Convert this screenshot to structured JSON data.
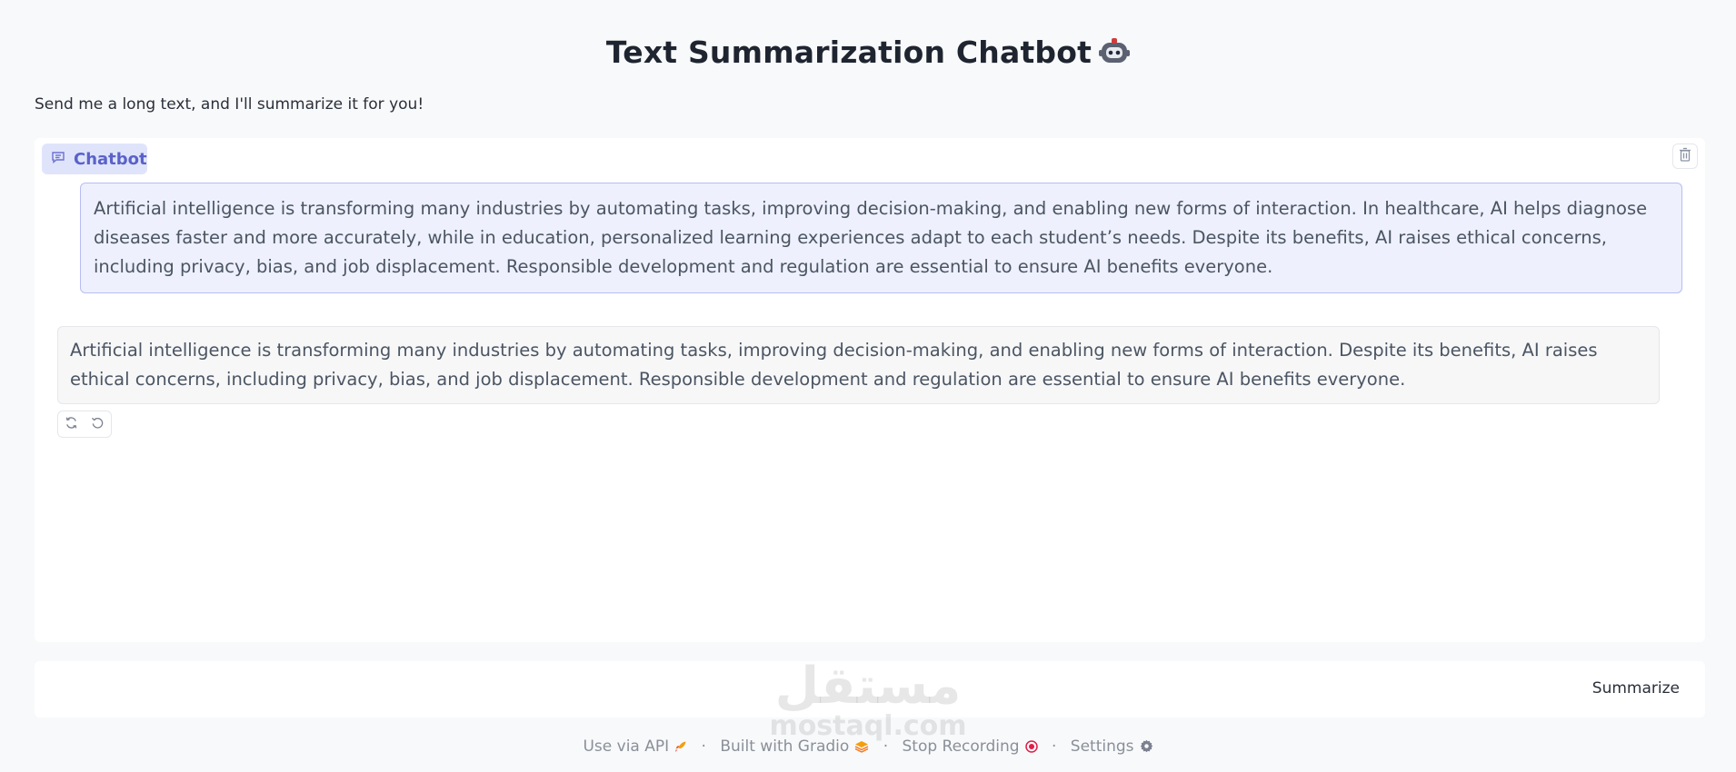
{
  "header": {
    "title": "Text Summarization Chatbot",
    "subtitle": "Send me a long text, and I'll summarize it for you!"
  },
  "chatbot": {
    "label": "Chatbot",
    "messages": [
      {
        "role": "user",
        "text": "Artificial intelligence is transforming many industries by automating tasks, improving decision-making, and enabling new forms of interaction. In healthcare, AI helps diagnose diseases faster and more accurately, while in education, personalized learning experiences adapt to each student’s needs. Despite its benefits, AI raises ethical concerns, including privacy, bias, and job displacement. Responsible development and regulation are essential to ensure AI benefits everyone."
      },
      {
        "role": "bot",
        "text": "Artificial intelligence is transforming many industries by automating tasks, improving decision-making, and enabling new forms of interaction. Despite its benefits, AI raises ethical concerns, including privacy, bias, and job displacement. Responsible development and regulation are essential to ensure AI benefits everyone."
      }
    ]
  },
  "input": {
    "submit_label": "Summarize"
  },
  "watermark": {
    "arabic": "مستقل",
    "latin": "mostaql.com"
  },
  "footer": {
    "api": "Use via API",
    "built": "Built with Gradio",
    "stop": "Stop Recording",
    "settings": "Settings"
  },
  "icons": {
    "title": "robot-icon",
    "chatbot": "chat-bubble-icon",
    "clear": "trash-icon",
    "retry": "refresh-icon",
    "undo": "undo-icon",
    "api": "rocket-icon",
    "gradio": "gradio-logo-icon",
    "stop": "record-icon",
    "settings": "gear-icon"
  },
  "colors": {
    "accent": "#5a62c9",
    "user_bubble": "#eef0fd",
    "user_border": "#b7bef3",
    "bot_bubble": "#f7f7f8",
    "record": "#e11d48"
  }
}
